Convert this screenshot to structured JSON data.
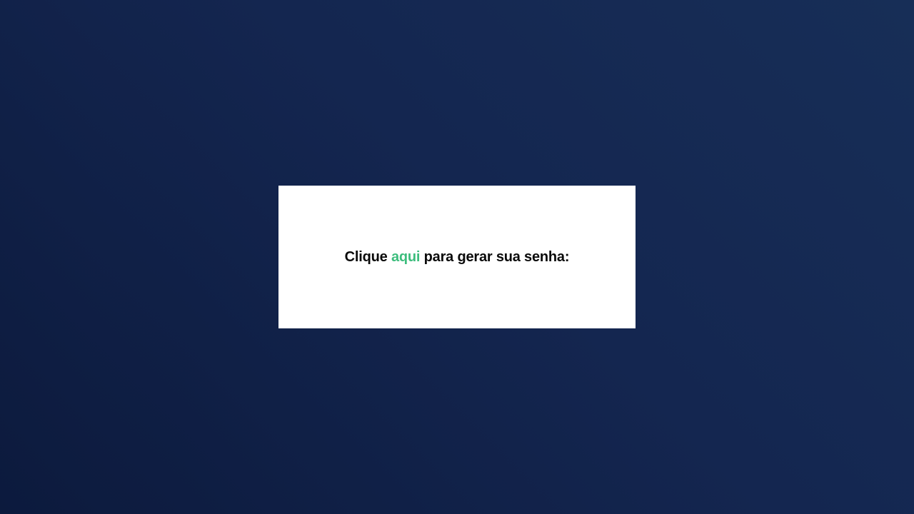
{
  "card": {
    "prefix": "Clique ",
    "link_label": "aqui",
    "suffix": " para gerar sua senha:"
  },
  "colors": {
    "background_start": "#0c1a3d",
    "background_end": "#172e57",
    "card": "#ffffff",
    "text": "#0a0a0a",
    "link": "#3dbd7d"
  }
}
